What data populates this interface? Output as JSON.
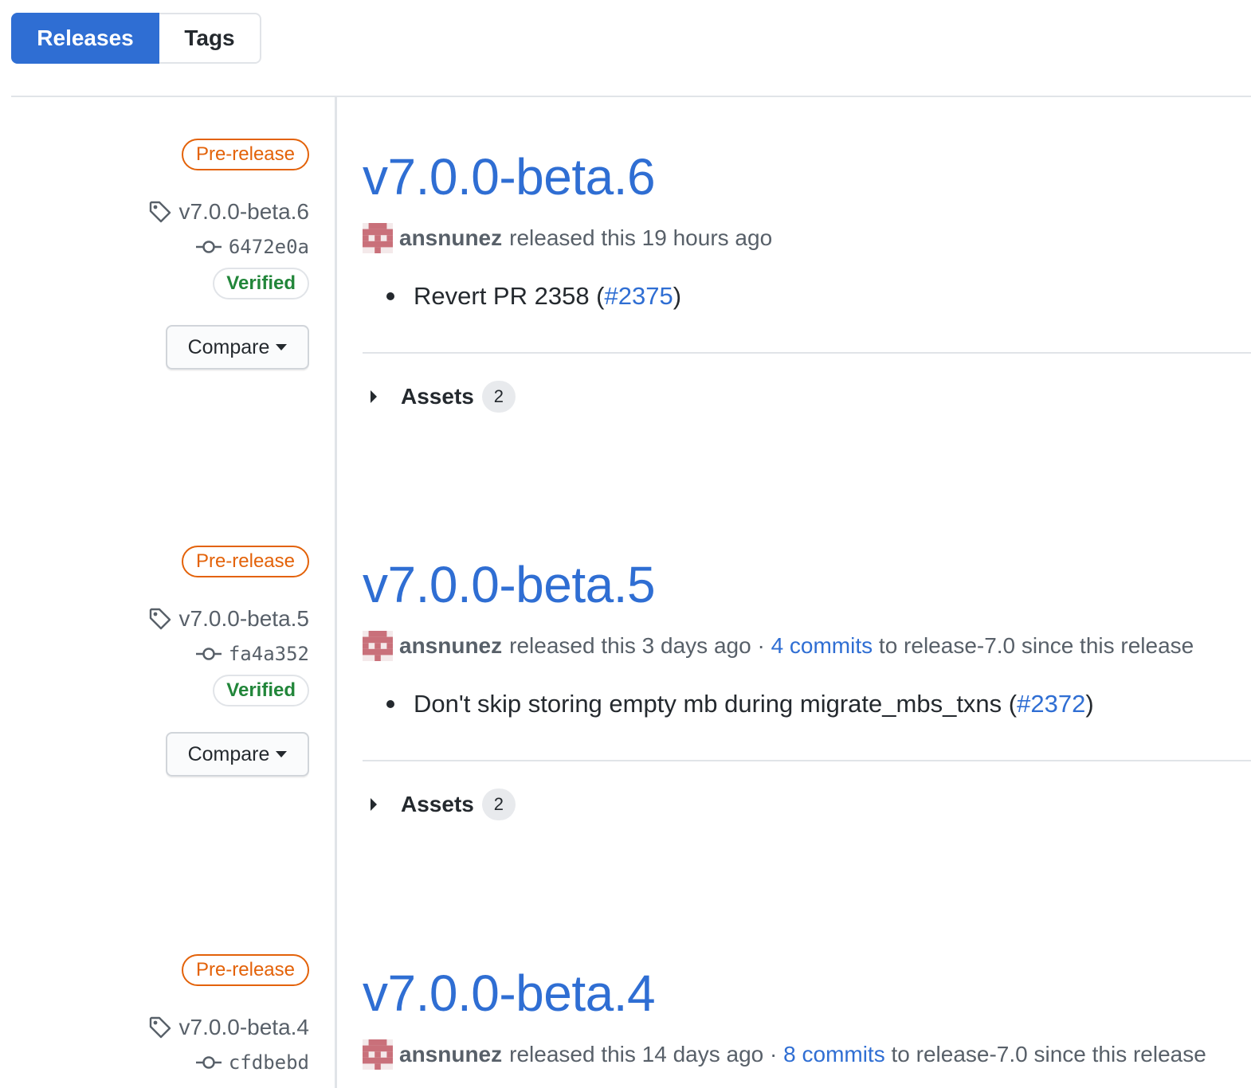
{
  "tabs": [
    {
      "label": "Releases",
      "active": true
    },
    {
      "label": "Tags",
      "active": false
    }
  ],
  "colors": {
    "accent": "#2f6ed3",
    "prerelease": "#e36209",
    "verified": "#22863a",
    "muted": "#586069"
  },
  "releases": [
    {
      "badge": "Pre-release",
      "tag": "v7.0.0-beta.6",
      "commit": "6472e0a",
      "verified": "Verified",
      "compare": "Compare",
      "title": "v7.0.0-beta.6",
      "author": "ansnunez",
      "released": "released this 19 hours ago",
      "sep": "",
      "commits_link": "",
      "commits_suffix": "",
      "note_prefix": "Revert PR 2358 (",
      "note_link": "#2375",
      "note_suffix": ")",
      "assets_label": "Assets",
      "assets_count": "2"
    },
    {
      "badge": "Pre-release",
      "tag": "v7.0.0-beta.5",
      "commit": "fa4a352",
      "verified": "Verified",
      "compare": "Compare",
      "title": "v7.0.0-beta.5",
      "author": "ansnunez",
      "released": "released this 3 days ago",
      "sep": " · ",
      "commits_link": "4 commits",
      "commits_suffix": " to release-7.0 since this release",
      "note_prefix": "Don't skip storing empty mb during migrate_mbs_txns (",
      "note_link": "#2372",
      "note_suffix": ")",
      "assets_label": "Assets",
      "assets_count": "2"
    },
    {
      "badge": "Pre-release",
      "tag": "v7.0.0-beta.4",
      "commit": "cfdbebd",
      "title": "v7.0.0-beta.4",
      "author": "ansnunez",
      "released": "released this 14 days ago",
      "sep": " · ",
      "commits_link": "8 commits",
      "commits_suffix": " to release-7.0 since this release"
    }
  ]
}
